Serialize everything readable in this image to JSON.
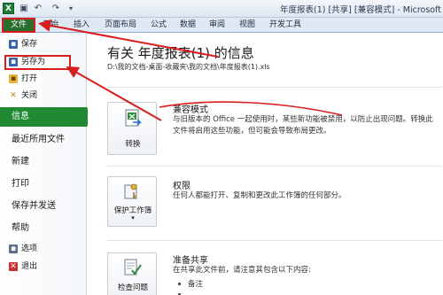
{
  "window": {
    "app_icon_letter": "X",
    "document_title": "年度报表(1) [共享] [兼容模式] - Microsoft"
  },
  "qat": {
    "save_glyph": "▣",
    "undo_glyph": "↶",
    "redo_glyph": "↷",
    "custom_glyph": "▾"
  },
  "tabs": [
    {
      "label": "文件"
    },
    {
      "label": "开始"
    },
    {
      "label": "插入"
    },
    {
      "label": "页面布局"
    },
    {
      "label": "公式"
    },
    {
      "label": "数据"
    },
    {
      "label": "审阅"
    },
    {
      "label": "视图"
    },
    {
      "label": "开发工具"
    }
  ],
  "nav": {
    "save": "保存",
    "save_as": "另存为",
    "open": "打开",
    "close": "关闭",
    "info": "信息",
    "recent": "最近所用文件",
    "new": "新建",
    "print": "打印",
    "save_send": "保存并发送",
    "help": "帮助",
    "options": "选项",
    "exit": "退出"
  },
  "main": {
    "title": "有关 年度报表(1) 的信息",
    "path": "D:\\我的文档-桌面-收藏夹\\我的文档\\年度报表(1).xls",
    "compat": {
      "button": "转换",
      "title": "兼容模式",
      "desc": "与旧版本的 Office 一起使用时，某些新功能被禁用，以防止出现问题。转换此文件将启用这些功能，但可能会导致布局更改。"
    },
    "perm": {
      "button": "保护工作簿",
      "button_arrow": "▾",
      "title": "权限",
      "desc": "任何人都能打开、复制和更改此工作簿的任何部分。"
    },
    "share": {
      "button": "检查问题",
      "title": "准备共享",
      "desc": "在共享此文件前，请注意其包含以下内容:",
      "items": [
        "备注"
      ]
    }
  },
  "colors": {
    "file_tab": "#2a6e2f",
    "active_nav": "#1f8a33",
    "annotation_red": "#d81d1d"
  }
}
